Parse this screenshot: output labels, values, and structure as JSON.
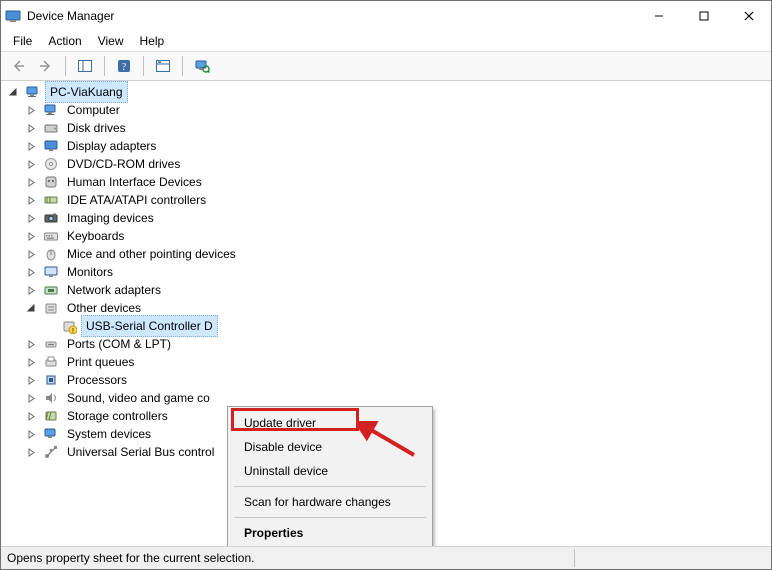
{
  "window": {
    "title": "Device Manager"
  },
  "menu": {
    "file": "File",
    "action": "Action",
    "view": "View",
    "help": "Help"
  },
  "root": {
    "label": "PC-ViaKuang"
  },
  "categories": [
    {
      "key": "computer",
      "label": "Computer",
      "icon": "computer"
    },
    {
      "key": "diskdrives",
      "label": "Disk drives",
      "icon": "disk"
    },
    {
      "key": "displayadapters",
      "label": "Display adapters",
      "icon": "display"
    },
    {
      "key": "dvd",
      "label": "DVD/CD-ROM drives",
      "icon": "dvd"
    },
    {
      "key": "hid",
      "label": "Human Interface Devices",
      "icon": "hid"
    },
    {
      "key": "ide",
      "label": "IDE ATA/ATAPI controllers",
      "icon": "ide"
    },
    {
      "key": "imaging",
      "label": "Imaging devices",
      "icon": "imaging"
    },
    {
      "key": "keyboards",
      "label": "Keyboards",
      "icon": "keyboard"
    },
    {
      "key": "mice",
      "label": "Mice and other pointing devices",
      "icon": "mouse"
    },
    {
      "key": "monitors",
      "label": "Monitors",
      "icon": "monitor"
    },
    {
      "key": "network",
      "label": "Network adapters",
      "icon": "network"
    },
    {
      "key": "other",
      "label": "Other devices",
      "icon": "other",
      "expanded": true,
      "children": [
        {
          "label": "USB-Serial Controller D",
          "icon": "unknown",
          "selected": true
        }
      ]
    },
    {
      "key": "ports",
      "label": "Ports (COM & LPT)",
      "icon": "ports"
    },
    {
      "key": "printq",
      "label": "Print queues",
      "icon": "printq"
    },
    {
      "key": "processors",
      "label": "Processors",
      "icon": "cpu"
    },
    {
      "key": "sound",
      "label": "Sound, video and game co",
      "icon": "sound"
    },
    {
      "key": "storage",
      "label": "Storage controllers",
      "icon": "storage"
    },
    {
      "key": "system",
      "label": "System devices",
      "icon": "system"
    },
    {
      "key": "usb",
      "label": "Universal Serial Bus control",
      "icon": "usb"
    }
  ],
  "contextMenu": {
    "update": "Update driver",
    "disable": "Disable device",
    "uninstall": "Uninstall device",
    "scan": "Scan for hardware changes",
    "properties": "Properties"
  },
  "statusbar": "Opens property sheet for the current selection."
}
